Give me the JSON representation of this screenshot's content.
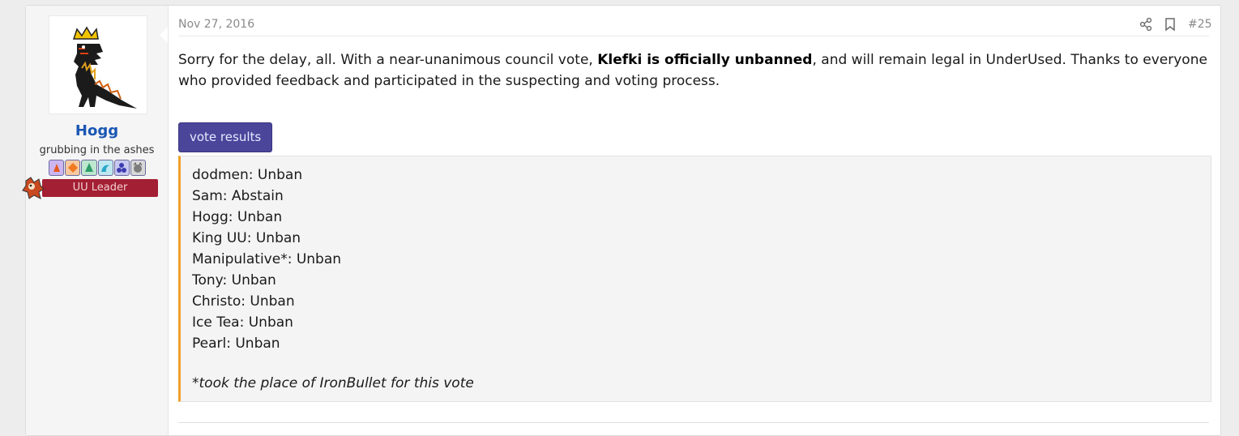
{
  "post": {
    "date": "Nov 27, 2016",
    "number": "#25",
    "message_part1": "Sorry for the delay, all. With a near-unanimous council vote, ",
    "message_bold": "Klefki is officially unbanned",
    "message_part2": ", and will remain legal in UnderUsed. Thanks to everyone who provided feedback and participated in the suspecting and voting process.",
    "spoiler_label": "vote results",
    "votes": [
      "dodmen: Unban",
      "Sam: Abstain",
      "Hogg: Unban",
      "King UU: Unban",
      "Manipulative*: Unban",
      "Tony: Unban",
      "Christo: Unban",
      "Ice Tea: Unban",
      "Pearl: Unban"
    ],
    "footnote": "*took the place of IronBullet for this vote"
  },
  "user": {
    "name": "Hogg",
    "title": "grubbing in the ashes",
    "role": "UU Leader",
    "badges": [
      "fire-badge-icon",
      "diamond-badge-icon",
      "leaf-badge-icon",
      "wave-badge-icon",
      "trio-badge-icon",
      "cat-badge-icon"
    ]
  },
  "colors": {
    "username": "#1a57b3",
    "role_banner": "#a31f33",
    "spoiler_button": "#4b469a",
    "spoiler_accent": "#f0a029"
  }
}
